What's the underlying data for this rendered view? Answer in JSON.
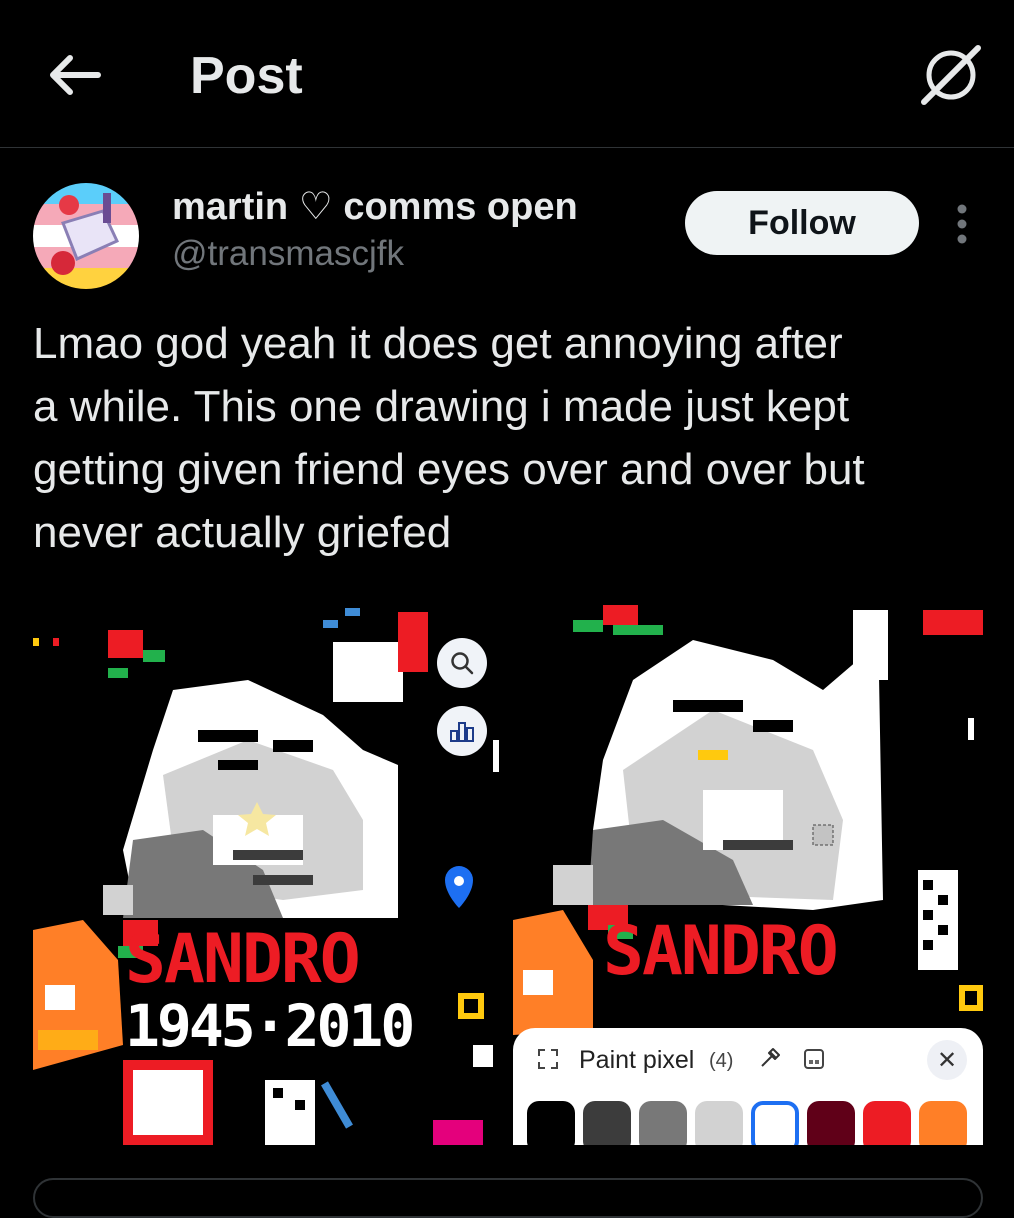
{
  "header": {
    "title": "Post",
    "back_icon": "arrow-left-icon",
    "grok_icon": "grok-icon"
  },
  "author": {
    "name": "martin ♡ comms open",
    "handle": "@transmascjfk",
    "follow_label": "Follow"
  },
  "tweet": {
    "text": "Lmao god yeah it does get annoying after\na while. This one drawing i made just kept\ngetting given friend eyes over and over but\nnever actually griefed"
  },
  "media": {
    "left": {
      "banner_text": "SANDRO",
      "years_text": "1945·2010"
    },
    "right": {
      "banner_text": "SANDRO"
    },
    "paint_panel": {
      "label": "Paint pixel",
      "count": "(4)",
      "swatches": [
        "#000000",
        "#3c3c3c",
        "#787878",
        "#d2d2d2",
        "#ffffff",
        "#600018",
        "#ed1c24",
        "#ff7f27"
      ],
      "selected_swatch": "#ffffff"
    }
  },
  "colors": {
    "accent": "#1d9bf0",
    "follow_bg": "#eff3f4",
    "muted": "#71767b"
  }
}
